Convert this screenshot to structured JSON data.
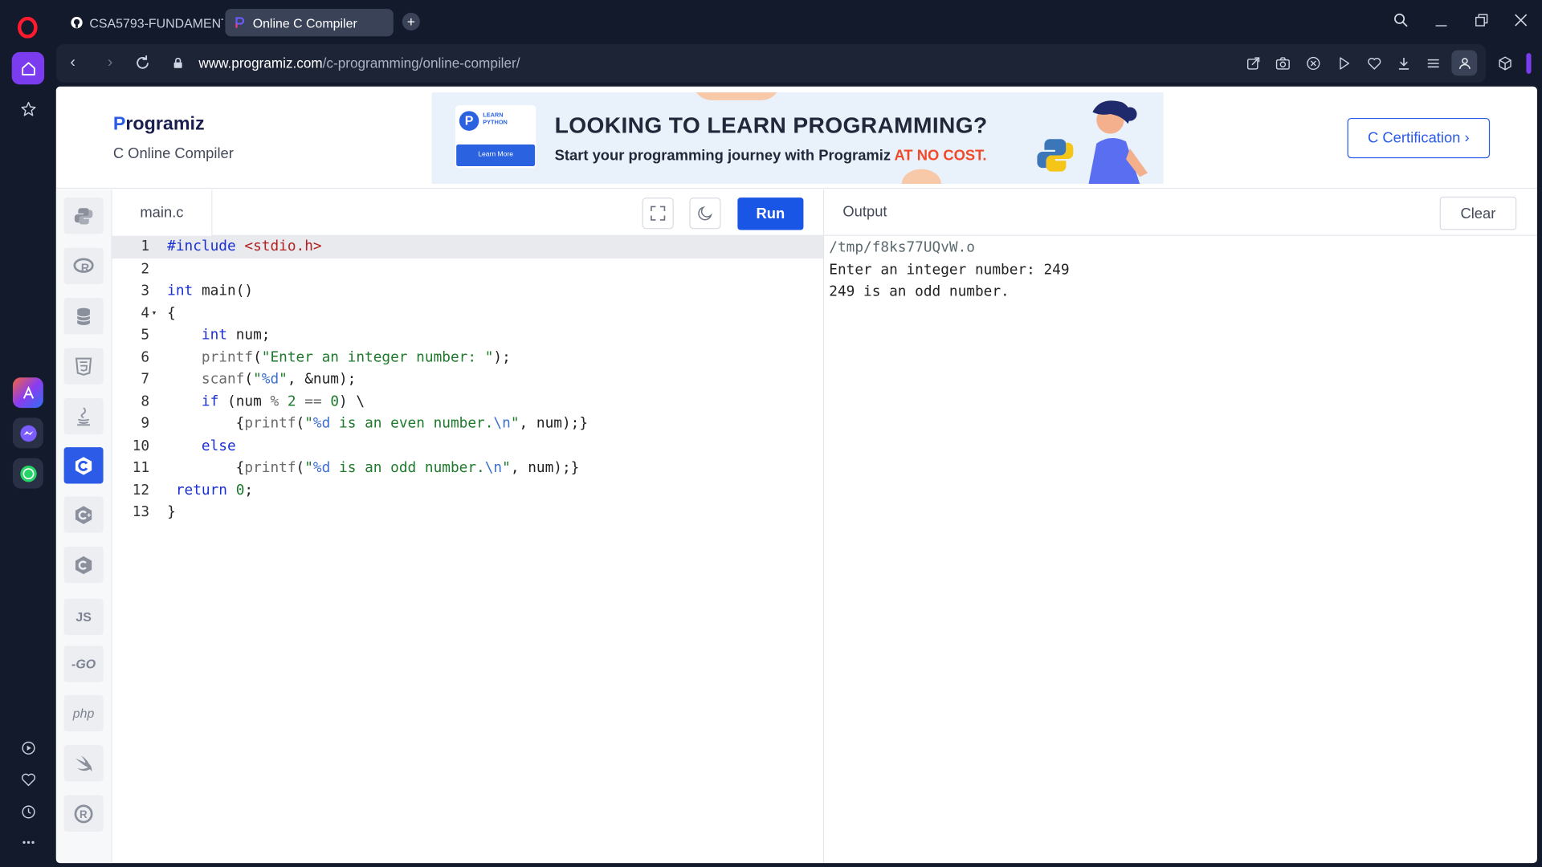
{
  "browser": {
    "tabs": [
      {
        "title": "CSA5793-FUNDAMENTAL"
      },
      {
        "title": "Online C Compiler"
      }
    ],
    "url_host": "www.programiz.com",
    "url_path": "/c-programming/online-compiler/",
    "new_tab_label": "+"
  },
  "header": {
    "logo_text": "rogramiz",
    "logo_p": "P",
    "subtitle": "C Online Compiler",
    "cert_button": "C Certification ›"
  },
  "banner": {
    "card_label": "LEARN PYTHON",
    "card_button": "Learn More",
    "title": "LOOKING TO LEARN PROGRAMMING?",
    "subtitle_lead": "Start your programming journey with Programiz ",
    "subtitle_highlight": "AT NO COST."
  },
  "languages": [
    {
      "name": "python",
      "label": ""
    },
    {
      "name": "r",
      "label": ""
    },
    {
      "name": "sql",
      "label": ""
    },
    {
      "name": "html",
      "label": ""
    },
    {
      "name": "java",
      "label": ""
    },
    {
      "name": "c",
      "label": "",
      "active": true
    },
    {
      "name": "cpp",
      "label": ""
    },
    {
      "name": "csharp",
      "label": ""
    },
    {
      "name": "javascript",
      "label": "JS"
    },
    {
      "name": "go",
      "label": "-GO"
    },
    {
      "name": "php",
      "label": "php"
    },
    {
      "name": "swift",
      "label": ""
    },
    {
      "name": "rust",
      "label": ""
    }
  ],
  "editor": {
    "filename": "main.c",
    "run_label": "Run",
    "line_numbers": [
      "1",
      "2",
      "3",
      "4",
      "5",
      "6",
      "7",
      "8",
      "9",
      "10",
      "11",
      "12",
      "13"
    ]
  },
  "output": {
    "title": "Output",
    "clear_label": "Clear",
    "lines": [
      "/tmp/f8ks77UQvW.o",
      "Enter an integer number: 249",
      "249 is an odd number."
    ]
  }
}
